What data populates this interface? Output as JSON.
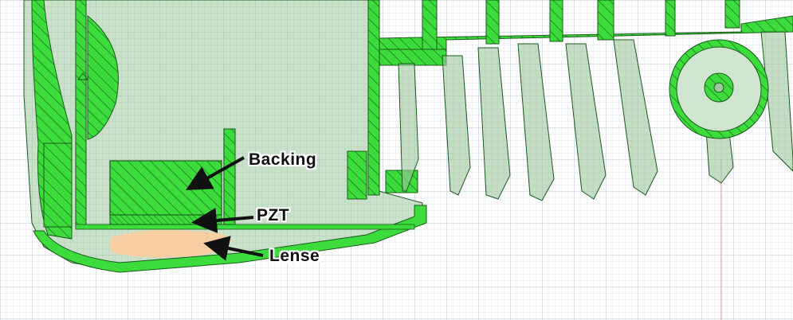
{
  "labels": {
    "backing": "Backing",
    "pzt": "PZT",
    "lense": "Lense"
  },
  "colors": {
    "background": "#ffffff",
    "grid_minor": "#d4dbe3",
    "grid_major": "#b7c3d0",
    "body_fill": "#9cc79c",
    "section_green": "#3ddc3d",
    "hatch_dark": "#1f7a1f",
    "outline": "#1a5a1a",
    "lense_fill": "#f7cda2",
    "arrow": "#111111",
    "axis_red": "#e0a3a3"
  },
  "icons": {
    "arrow": "arrow-icon",
    "triangle_marker": "triangle-marker-icon"
  }
}
